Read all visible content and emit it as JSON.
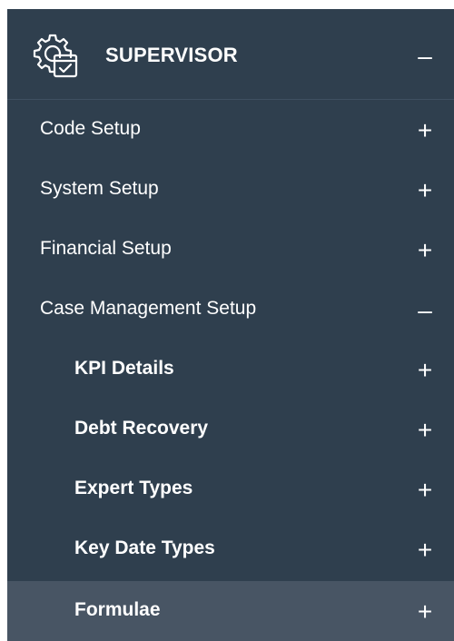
{
  "menu": {
    "header": {
      "title": "SUPERVISOR",
      "icon": "settings-calendar-icon",
      "toggle": "–"
    },
    "items": [
      {
        "label": "Code Setup",
        "toggle": "+",
        "level": 1,
        "active": false
      },
      {
        "label": "System Setup",
        "toggle": "+",
        "level": 1,
        "active": false
      },
      {
        "label": "Financial Setup",
        "toggle": "+",
        "level": 1,
        "active": false
      },
      {
        "label": "Case Management Setup",
        "toggle": "–",
        "level": 1,
        "active": false
      },
      {
        "label": "KPI Details",
        "toggle": "+",
        "level": 2,
        "active": false
      },
      {
        "label": "Debt Recovery",
        "toggle": "+",
        "level": 2,
        "active": false
      },
      {
        "label": "Expert Types",
        "toggle": "+",
        "level": 2,
        "active": false
      },
      {
        "label": "Key Date Types",
        "toggle": "+",
        "level": 2,
        "active": false
      },
      {
        "label": "Formulae",
        "toggle": "+",
        "level": 2,
        "active": true
      }
    ]
  },
  "colors": {
    "background": "#2f3f4e",
    "active_row": "#485564",
    "text": "#ffffff"
  }
}
